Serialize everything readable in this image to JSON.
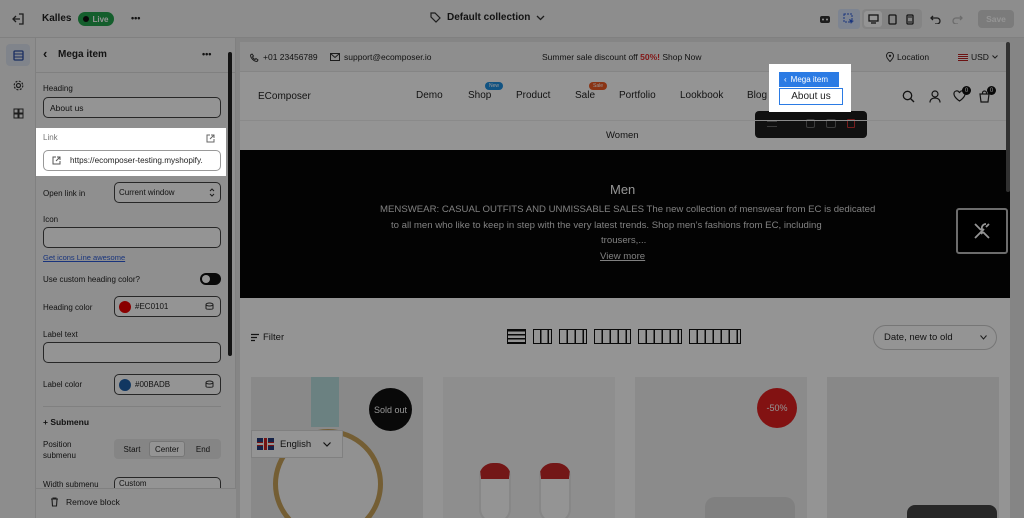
{
  "topbar": {
    "store_name": "Kalles",
    "live_badge": "Live",
    "more_glyph": "•••",
    "collection": "Default collection",
    "save_label": "Save",
    "icons": [
      "exit-icon",
      "tag-icon",
      "chevron-down-icon",
      "ai-icon",
      "select-icon",
      "desktop-icon",
      "tablet-icon",
      "mobile-icon",
      "undo-icon",
      "redo-icon"
    ]
  },
  "sidebar": {
    "title": "Mega item",
    "back_glyph": "‹",
    "more_glyph": "•••",
    "heading_label": "Heading",
    "heading_value": "About us",
    "link_label": "Link",
    "link_value": "https://ecomposer-testing.myshopify.",
    "open_link_label": "Open link in",
    "open_link_value": "Current window",
    "icon_label": "Icon",
    "icon_value": "",
    "icons_link": "Get icons Line awesome",
    "custom_heading_label": "Use custom heading color?",
    "heading_color_label": "Heading color",
    "heading_color_value": "#EC0101",
    "heading_color": "#EC0101",
    "label_text_label": "Label text",
    "label_text_value": "",
    "label_color_label": "Label color",
    "label_color_value": "#00BADB",
    "label_color": "#1e5fa8",
    "submenu_header": "+ Submenu",
    "position_label": "Position submenu",
    "positions": [
      "Start",
      "Center",
      "End"
    ],
    "active_position": "Center",
    "width_label": "Width submenu",
    "width_value": "Custom",
    "remove_label": "Remove block"
  },
  "rail": {
    "icons": [
      "layers-icon",
      "settings-gear-icon",
      "apps-icon"
    ]
  },
  "preview": {
    "phone": "+01 23456789",
    "email": "support@ecomposer.io",
    "promo_prefix": "Summer sale discount off ",
    "promo_highlight": "50%!",
    "promo_suffix": " Shop Now",
    "location": "Location",
    "currency": "USD",
    "logo": "EComposer",
    "nav": [
      "Demo",
      "Shop",
      "Product",
      "Sale",
      "Portfolio",
      "Lookbook",
      "Blog",
      "About us"
    ],
    "badge_new": "New",
    "badge_sale": "Sale",
    "wishlist_count": "0",
    "cart_count": "0",
    "mega_tag": "Mega item",
    "mega_tag_glyph": "‹",
    "submenu_item": "Women",
    "hero_title": "Men",
    "hero_text_1": "MENSWEAR: CASUAL OUTFITS AND UNMISSABLE SALES The new collection of menswear from EC is dedicated",
    "hero_text_2": "to all men who like to keep in step with the very latest trends. Shop men’s fashions from EC, including",
    "hero_text_3": "trousers,...",
    "view_more": "View more",
    "filter_label": "Filter",
    "sort_value": "Date, new to old",
    "grid_options": [
      1,
      2,
      3,
      4,
      5,
      6
    ],
    "sold_out": "Sold out",
    "discount": "-50%",
    "language": "English"
  },
  "colors": {
    "accent_blue": "#2b7be4",
    "live_green": "#23a24d",
    "sale_orange": "#ee5a24",
    "promo_red": "#e02a2a"
  }
}
